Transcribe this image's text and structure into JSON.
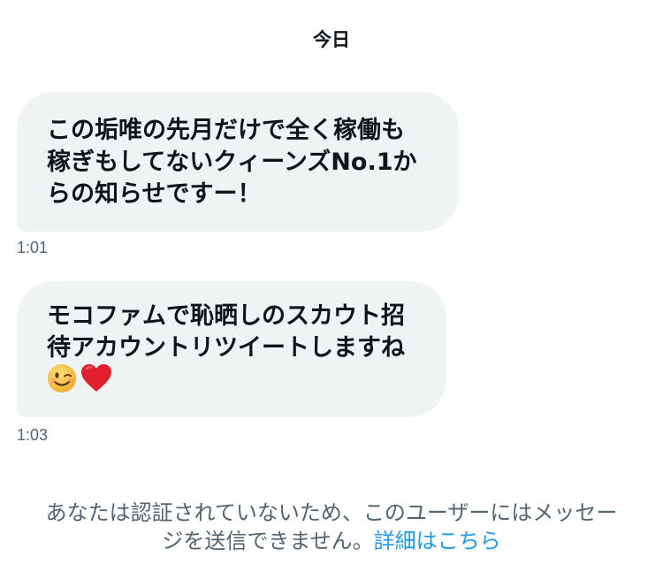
{
  "date_header": "今日",
  "messages": [
    {
      "lines": [
        "この垢唯の先月だけで全く稼働も",
        "稼ぎもしてないクィーンズNo.1か",
        "らの知らせですー！"
      ],
      "time": "1:01"
    },
    {
      "lines": [
        "モコファムで恥晒しのスカウト招",
        "待アカウントリツイートしますね"
      ],
      "emoji": [
        "winking-face",
        "red-heart"
      ],
      "time": "1:03"
    }
  ],
  "notice": {
    "line1": "あなたは認証されていないため、このユーザーにはメッセー",
    "line2_prefix": "ジを送信できません。",
    "link_label": "詳細はこちら"
  },
  "colors": {
    "bubble": "#eff3f4",
    "text": "#0f1419",
    "secondary_text": "#536471",
    "link": "#1d9bf0",
    "heart": "#e0202e",
    "wink_face": "#f5c542"
  }
}
